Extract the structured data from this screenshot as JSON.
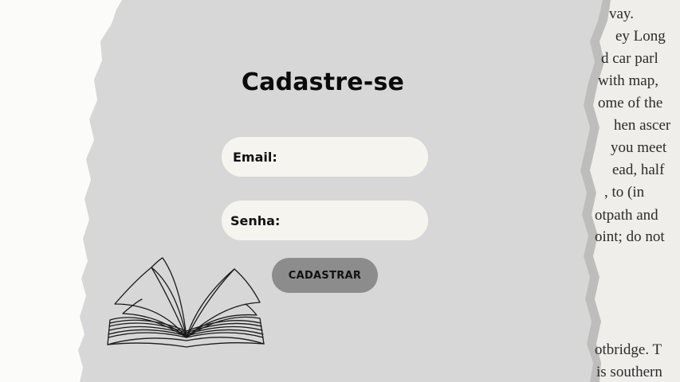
{
  "form": {
    "title": "Cadastre-se",
    "email_label": "Email:",
    "email_value": "",
    "password_label": "Senha:",
    "password_value": "",
    "submit_label": "CADASTRAR"
  },
  "decor": {
    "page_text_lines": [
      "vay.",
      "ey Long",
      "d car parl",
      "with map,",
      "ome of the",
      "hen ascer",
      "you meet",
      "ead, half",
      ", to (in",
      "otpath and",
      "oint; do not",
      "otbridge. T",
      "is southern"
    ],
    "book_icon": "open-book-illustration"
  },
  "colors": {
    "panel": "#d7d7d7",
    "field": "#f6f4ef",
    "button": "#8c8c8c",
    "paper": "#fbfbf9"
  }
}
